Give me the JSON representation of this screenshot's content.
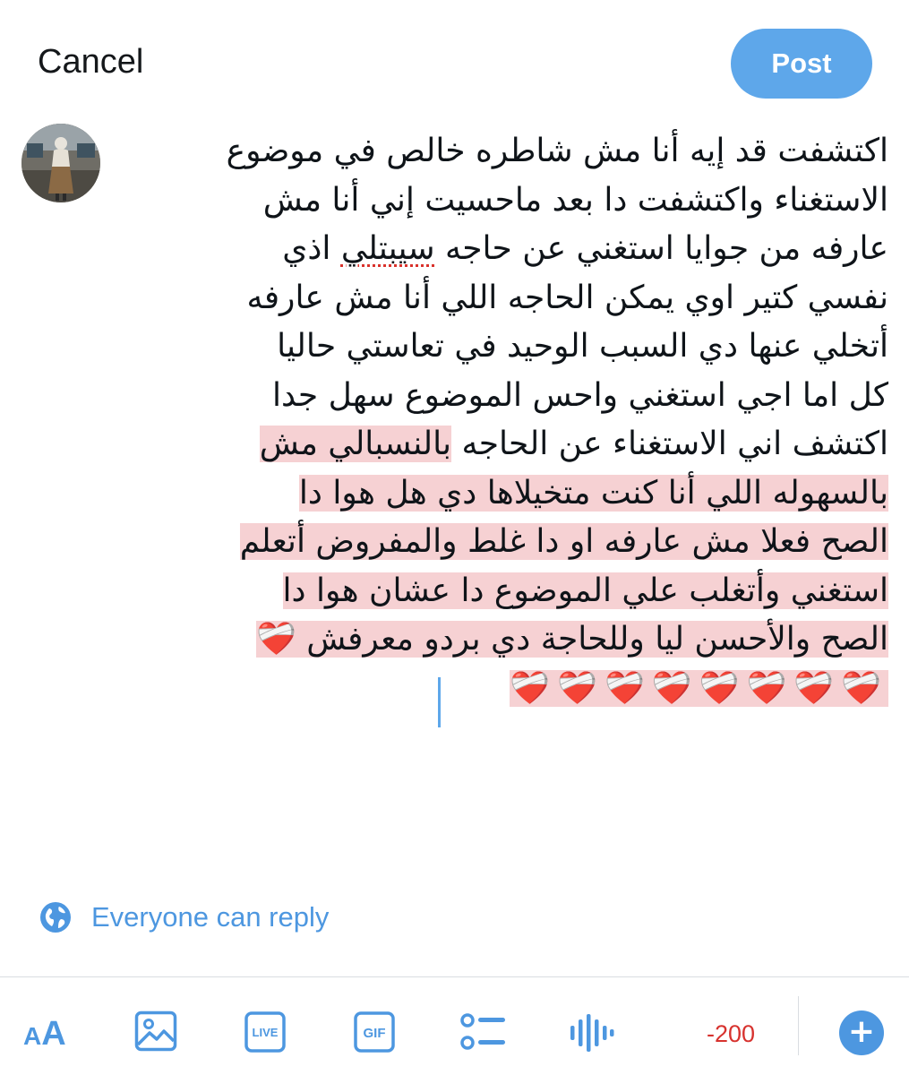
{
  "header": {
    "cancel_label": "Cancel",
    "post_label": "Post"
  },
  "compose": {
    "lines": [
      "اكتشفت قد إيه أنا مش شاطره خالص في موضوع",
      "الاستغناء واكتشفت دا بعد ماحسيت إني أنا مش",
      "عارفه من جوايا استغني عن حاجه ",
      "سيبتلي",
      " اذي",
      "نفسي كتير اوي يمكن الحاجه اللي أنا مش عارفه",
      "أتخلي عنها دي السبب الوحيد في تعاستي حاليا",
      "كل اما اجي استغني واحس الموضوع سهل جدا",
      "اكتشف اني الاستغناء عن الحاجه ",
      "بالنسبالي مش",
      "بالسهوله اللي أنا كنت متخيلاها دي هل هوا دا",
      "الصح فعلا مش عارفه او دا غلط والمفروض أتعلم",
      "استغني وأتغلب علي الموضوع دا عشان هوا دا",
      "الصح والأحسن ليا وللحاجة دي بردو معرفش ",
      "❤️‍🩹",
      "❤️‍🩹❤️‍🩹❤️‍🩹❤️‍🩹❤️‍🩹❤️‍🩹❤️‍🩹❤️‍🩹"
    ]
  },
  "reply": {
    "label": "Everyone can reply",
    "icon": "globe-icon"
  },
  "toolbar": {
    "aa_small": "A",
    "aa_big": "A",
    "live_label": "LIVE",
    "gif_label": "GIF",
    "char_count": "-200",
    "plus_label": "+",
    "icons": [
      "text-size-icon",
      "image-icon",
      "live-icon",
      "gif-icon",
      "poll-icon",
      "voice-icon",
      "add-thread-icon"
    ]
  },
  "colors": {
    "accent": "#4d97e0",
    "post_button": "#5ea7ea",
    "highlight": "#f6d1d3",
    "count_over": "#d7322e"
  }
}
